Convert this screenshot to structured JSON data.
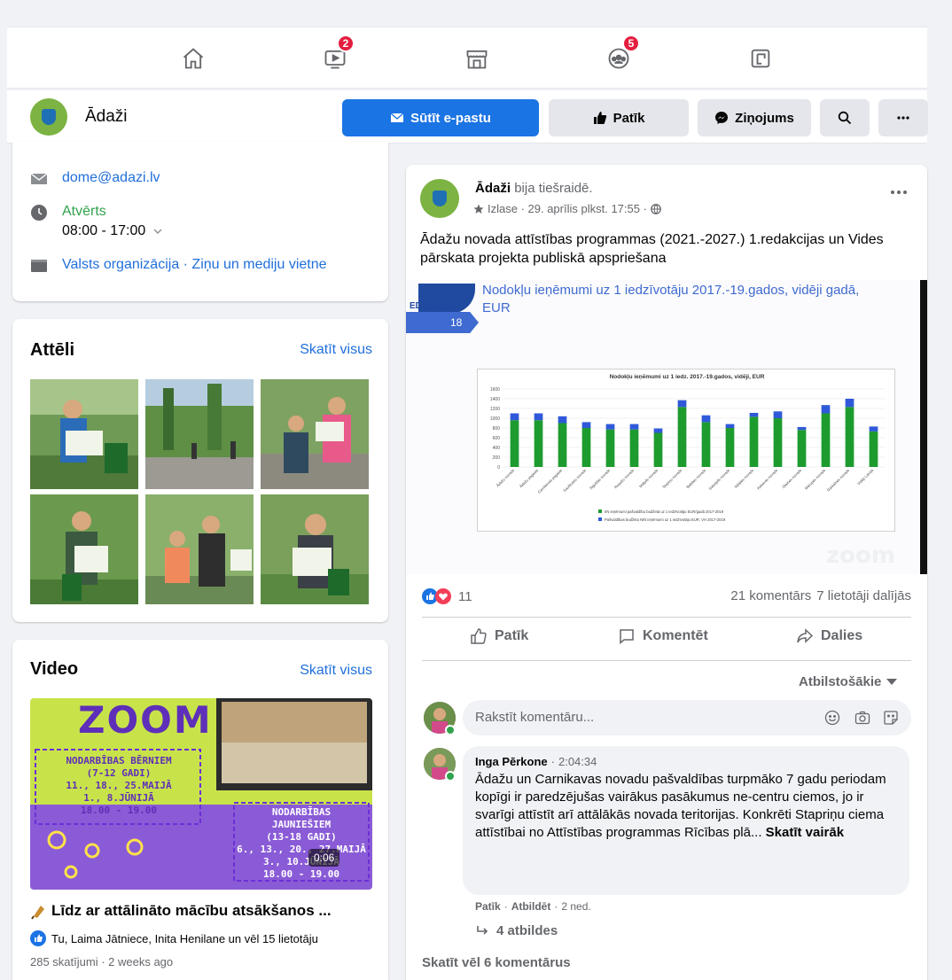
{
  "nav": {
    "tabs": [
      {
        "name": "home"
      },
      {
        "name": "watch",
        "badge": "2"
      },
      {
        "name": "marketplace"
      },
      {
        "name": "groups",
        "badge": "5"
      },
      {
        "name": "gaming"
      }
    ]
  },
  "page": {
    "name": "Ādaži",
    "buttons": {
      "email": "Sūtīt e-pastu",
      "like": "Patīk",
      "message": "Ziņojums"
    }
  },
  "intro": {
    "email": "dome@adazi.lv",
    "status": "Atvērts",
    "hours": "08:00 - 17:00",
    "categories": "Valsts organizācija · Ziņu un mediju vietne"
  },
  "photos": {
    "title": "Attēli",
    "see_all": "Skatīt visus"
  },
  "videos": {
    "title": "Video",
    "see_all": "Skatīt visus",
    "thumb": {
      "zoom": "ZOOM",
      "kids_head": "NODARBĪBAS BĒRNIEM",
      "kids_age": "(7-12 GADI)",
      "kids_dates1": "11., 18., 25.MAIJĀ",
      "kids_dates2": "1., 8.JŪNIJĀ",
      "kids_time": "18.00 - 19.00",
      "teens_head": "NODARBĪBAS",
      "teens_head2": "JAUNIEŠIEM",
      "teens_age": "(13-18 GADI)",
      "teens_dates1": "6., 13., 20., 27.MAIJĀ",
      "teens_dates2": "3., 10.JŪNIJĀ",
      "teens_time": "18.00 - 19.00"
    },
    "duration": "0:06",
    "caption": "Līdz ar attālināto mācību atsākšanos ...",
    "reactors": "Tu, Laima Jātniece, Inita Henilane un vēl 15 lietotāju",
    "views": "285 skatījumi · 2 weeks ago"
  },
  "post": {
    "author": "Ādaži",
    "action": "bija tiešraidē.",
    "meta": "Izlase · 29. aprīlis plkst. 17:55 ·",
    "text": "Ādažu novada attīstības programmas (2021.-2027.) 1.redakcijas un Vides pārskata projekta publiskā apspriešana",
    "slide": {
      "brand": "EDO consult",
      "number": "18",
      "title": "Nodokļu ieņēmumi uz 1 iedzīvotāju 2017.-19.gados, vidēji gadā, EUR",
      "chart_title": "Nodokļu ieņēmumi uz 1 iedz. 2017.-19.gados, vidēji, EUR",
      "legend1": "IIN ieņēmumi pašvaldību budžetā uz 1 iedzīvotāju EUR/gadā 2017-2019",
      "legend2": "Pašvaldības budžeta NIN ieņēmumi uz 1 iedzīvotāju EUR, VH 2017-2019",
      "zoom_logo": "zoom"
    },
    "reactions_count": "11",
    "comments_count": "21 komentārs",
    "shares_count": "7 lietotāji dalījās",
    "actions": {
      "like": "Patīk",
      "comment": "Komentēt",
      "share": "Dalies"
    },
    "sort": "Atbilstošākie",
    "comment_placeholder": "Rakstīt komentāru...",
    "comment": {
      "author": "Inga Pērkone",
      "time": "2:04:34",
      "text": "Ādažu un Carnikavas novadu pašvaldības turpmāko 7 gadu periodam kopīgi ir paredzējušas vairākus pasākumus ne-centru ciemos, jo ir svarīgi attīstīt arī attālākās novada teritorijas. Konkrēti Stapriņu ciema attīstībai no Attīstības programmas Rīcības plā...",
      "see_more": "Skatīt vairāk",
      "like": "Patīk",
      "reply": "Atbildēt",
      "age": "2 ned.",
      "replies": "4 atbildes"
    },
    "more_comments": "Skatīt vēl 6 komentārus"
  },
  "colors": {
    "accent": "#1b74e4",
    "link": "#216fdb",
    "badge": "#e41e3f",
    "online": "#31a24c",
    "bar_green": "#1e9b2f",
    "bar_blue": "#2f59d9"
  },
  "chart_data": {
    "type": "bar",
    "title": "Nodokļu ieņēmumi uz 1 iedz. 2017.-19.gados, vidēji, EUR",
    "categories": [
      "Ādažu novads",
      "Ādažu pagasts",
      "Carnikavas pagasts",
      "Saulkrastu novads",
      "Siguldas novads",
      "Ropažu novads",
      "Mālpils novads",
      "Stopiņu novads",
      "Babītes novads",
      "Salaspils novads",
      "Ikšķiles novads",
      "Ķekavas novads",
      "Olaines novads",
      "Mārupes novads",
      "Garkalnes novads",
      "Vidēji Latvijā"
    ],
    "series": [
      {
        "name": "IIN ieņēmumi pašvaldību budžetā uz 1 iedzīvotāju EUR/gadā 2017-2019",
        "values": [
          960,
          960,
          900,
          800,
          770,
          770,
          700,
          1230,
          920,
          800,
          1030,
          1000,
          760,
          1100,
          1230,
          730
        ]
      },
      {
        "name": "Pašvaldības budžeta NIN ieņēmumi uz 1 iedzīvotāju EUR, VH 2017-2019",
        "values": [
          140,
          140,
          140,
          120,
          110,
          110,
          90,
          140,
          140,
          80,
          80,
          140,
          60,
          170,
          170,
          100
        ]
      }
    ],
    "ylim": [
      0,
      1600
    ],
    "yticks": [
      0,
      200,
      400,
      600,
      800,
      1000,
      1200,
      1400,
      1600
    ]
  }
}
